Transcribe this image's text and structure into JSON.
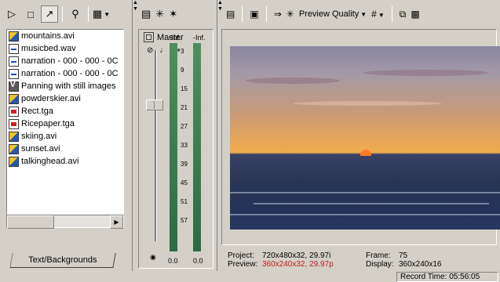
{
  "explorer": {
    "files": [
      {
        "name": "mountains.avi",
        "type": "avi"
      },
      {
        "name": "musicbed.wav",
        "type": "wav"
      },
      {
        "name": "narration - 000 - 000 - 0C",
        "type": "wav"
      },
      {
        "name": "narration - 000 - 000 - 0C",
        "type": "wav"
      },
      {
        "name": "Panning with still images",
        "type": "veg"
      },
      {
        "name": "powderskier.avi",
        "type": "avi"
      },
      {
        "name": "Rect.tga",
        "type": "tga"
      },
      {
        "name": "Ricepaper.tga",
        "type": "tga"
      },
      {
        "name": "skiing.avi",
        "type": "avi"
      },
      {
        "name": "sunset.avi",
        "type": "avi"
      },
      {
        "name": "talkinghead.avi",
        "type": "avi"
      }
    ],
    "tab_label": "Text/Backgrounds"
  },
  "mixer": {
    "master_label": "Master",
    "meter_left_header": "-Inf.",
    "meter_right_header": "-Inf.",
    "scale": [
      "3",
      "9",
      "15",
      "21",
      "27",
      "33",
      "39",
      "45",
      "51",
      "57"
    ],
    "left_value": "0.0",
    "right_value": "0.0"
  },
  "preview": {
    "quality_label": "Preview Quality",
    "project_label": "Project:",
    "project_value": "720x480x32, 29.97i",
    "preview_label": "Preview:",
    "preview_value": "360x240x32, 29.97p",
    "frame_label": "Frame:",
    "frame_value": "75",
    "display_label": "Display:",
    "display_value": "360x240x16"
  },
  "status": {
    "record_time": "Record Time: 05:56:05"
  },
  "colors": {
    "preview_value_red": "#c41a1a",
    "window_bg": "#d4d0c8"
  }
}
